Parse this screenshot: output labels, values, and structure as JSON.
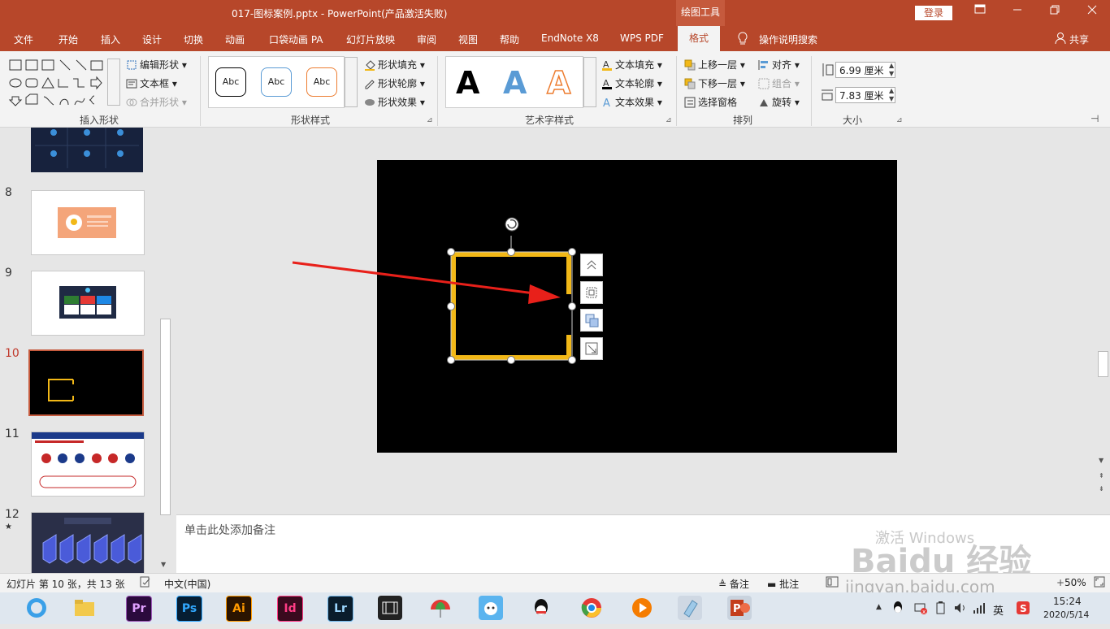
{
  "titlebar": {
    "title": "017-图标案例.pptx  -  PowerPoint(产品激活失败)",
    "context_tab": "绘图工具",
    "login": "登录"
  },
  "tabs": [
    "文件",
    "开始",
    "插入",
    "设计",
    "切换",
    "动画",
    "口袋动画 PA",
    "幻灯片放映",
    "审阅",
    "视图",
    "帮助",
    "EndNote X8",
    "WPS PDF",
    "格式"
  ],
  "active_tab": "格式",
  "tell_me": "操作说明搜索",
  "share": "共享",
  "ribbon": {
    "insert_shapes": {
      "label": "插入形状",
      "edit_shape": "编辑形状",
      "textbox": "文本框",
      "merge_shapes": "合并形状"
    },
    "shape_styles": {
      "label": "形状样式",
      "swatch_text": "Abc",
      "fill": "形状填充",
      "outline": "形状轮廓",
      "effects": "形状效果"
    },
    "wordart": {
      "label": "艺术字样式",
      "letter": "A",
      "text_fill": "文本填充",
      "text_outline": "文本轮廓",
      "text_effects": "文本效果"
    },
    "arrange": {
      "label": "排列",
      "bring_forward": "上移一层",
      "send_backward": "下移一层",
      "selection_pane": "选择窗格",
      "align": "对齐",
      "group": "组合",
      "rotate": "旋转"
    },
    "size": {
      "label": "大小",
      "height": "6.99 厘米",
      "width": "7.83 厘米"
    }
  },
  "thumbnails": [
    {
      "num": "",
      "star": ""
    },
    {
      "num": "8",
      "star": ""
    },
    {
      "num": "9",
      "star": ""
    },
    {
      "num": "10",
      "star": ""
    },
    {
      "num": "11",
      "star": ""
    },
    {
      "num": "12",
      "star": "★"
    }
  ],
  "notes_placeholder": "单击此处添加备注",
  "status": {
    "slide_info": "幻灯片 第 10 张，共 13 张",
    "language": "中文(中国)",
    "notes": "备注",
    "comments": "批注",
    "zoom": "50%"
  },
  "taskbar": {
    "apps": [
      "Pr",
      "Ps",
      "Ai",
      "Id",
      "Lr"
    ],
    "time": "15:24",
    "date": "2020/5/14",
    "ime": "英"
  },
  "watermark": {
    "activate": "激活 Windows",
    "brand": "Baidu 经验",
    "url": "jingyan.baidu.com"
  },
  "colors": {
    "accent": "#b7472a",
    "shape_outline": "#f2b817",
    "arrow": "#e8201a"
  }
}
